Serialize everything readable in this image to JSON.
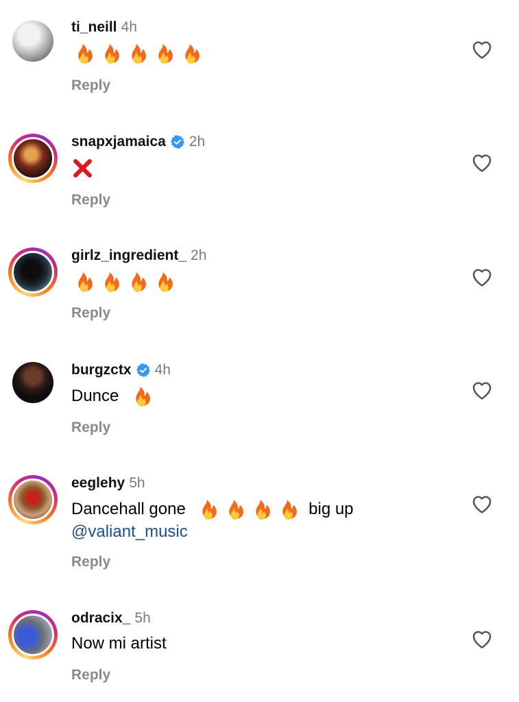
{
  "comments": [
    {
      "username": "ti_neill",
      "time": "4h",
      "verified": false,
      "story": false,
      "avatar": "av-ti",
      "text_before": "",
      "fire_count": 5,
      "cross": false,
      "text_after": "",
      "mention": "",
      "reply": "Reply"
    },
    {
      "username": "snapxjamaica",
      "time": "2h",
      "verified": true,
      "story": true,
      "avatar": "av-snap",
      "text_before": "",
      "fire_count": 0,
      "cross": true,
      "text_after": "",
      "mention": "",
      "reply": "Reply"
    },
    {
      "username": "girlz_ingredient_",
      "time": "2h",
      "verified": false,
      "story": true,
      "avatar": "av-girlz",
      "text_before": "",
      "fire_count": 4,
      "cross": false,
      "text_after": "",
      "mention": "",
      "reply": "Reply"
    },
    {
      "username": "burgzctx",
      "time": "4h",
      "verified": true,
      "story": false,
      "avatar": "av-burg",
      "text_before": "Dunce",
      "fire_count": 1,
      "cross": false,
      "text_after": "",
      "mention": "",
      "reply": "Reply"
    },
    {
      "username": "eeglehy",
      "time": "5h",
      "verified": false,
      "story": true,
      "avatar": "av-eegle",
      "text_before": "Dancehall gone",
      "fire_count": 4,
      "cross": false,
      "text_after": "big up",
      "mention": "@valiant_music",
      "reply": "Reply"
    },
    {
      "username": "odracix_",
      "time": "5h",
      "verified": false,
      "story": true,
      "avatar": "av-odra",
      "text_before": "Now mi artist",
      "fire_count": 0,
      "cross": false,
      "text_after": "",
      "mention": "",
      "reply": "Reply"
    }
  ],
  "icons": {
    "like": "heart-outline-icon",
    "verified": "verified-badge-icon",
    "emoji": "fire-emoji",
    "cross": "cross-mark-emoji"
  },
  "colors": {
    "verified": "#3897f0",
    "mention": "#1c4f8c",
    "muted": "#8a8a8a"
  }
}
